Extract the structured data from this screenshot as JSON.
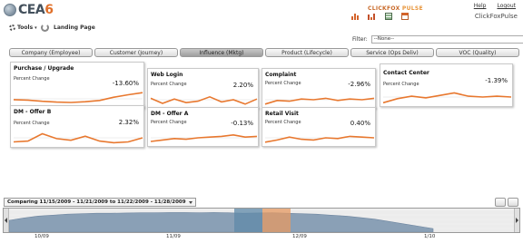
{
  "header": {
    "logo_text": "CEA",
    "logo_six": "6",
    "brand_left": "CLICKFOX",
    "brand_right": "PULSE",
    "links": [
      "Help",
      "Logout"
    ],
    "product_name": "ClickFoxPulse",
    "icons": [
      "bar-chart-icon",
      "column-chart-icon",
      "grid-icon",
      "calendar-icon"
    ]
  },
  "toolbar": {
    "tools_label": "Tools",
    "landing_label": "Landing Page"
  },
  "filter": {
    "label": "Filter:",
    "value": "--None--"
  },
  "tabs": [
    {
      "label": "Company (Employee)",
      "active": false
    },
    {
      "label": "Customer (Journey)",
      "active": false
    },
    {
      "label": "Influence (Mktg)",
      "active": true
    },
    {
      "label": "Product (Lifecycle)",
      "active": false
    },
    {
      "label": "Service (Ops Deliv)",
      "active": false
    },
    {
      "label": "VOC (Quality)",
      "active": false
    }
  ],
  "accent_color": "#e8782f",
  "cards": [
    {
      "title": "Purchase / Upgrade",
      "subtitle": "Percent Change",
      "value": "-13.60%",
      "series": [
        0.45,
        0.42,
        0.35,
        0.3,
        0.28,
        0.32,
        0.4,
        0.6,
        0.75,
        0.88
      ]
    },
    {
      "title": "Web Login",
      "subtitle": "Percent Change",
      "value": "2.20%",
      "series": [
        0.6,
        0.25,
        0.55,
        0.3,
        0.4,
        0.7,
        0.35,
        0.5,
        0.2,
        0.55
      ]
    },
    {
      "title": "Complaint",
      "subtitle": "Percent Change",
      "value": "-2.96%",
      "series": [
        0.2,
        0.45,
        0.4,
        0.55,
        0.5,
        0.6,
        0.45,
        0.55,
        0.5,
        0.6
      ]
    },
    {
      "title": "Contact Center",
      "subtitle": "Percent Change",
      "value": "-1.39%",
      "series": [
        0.15,
        0.4,
        0.55,
        0.45,
        0.6,
        0.75,
        0.55,
        0.5,
        0.55,
        0.5
      ]
    },
    {
      "title": "DM - Offer B",
      "subtitle": "Percent Change",
      "value": "2.32%",
      "series": [
        0.25,
        0.3,
        0.75,
        0.45,
        0.35,
        0.6,
        0.3,
        0.2,
        0.25,
        0.5
      ]
    },
    {
      "title": "DM - Offer A",
      "subtitle": "Percent Change",
      "value": "-0.13%",
      "series": [
        0.25,
        0.35,
        0.45,
        0.4,
        0.5,
        0.55,
        0.6,
        0.7,
        0.55,
        0.6
      ]
    },
    {
      "title": "Retail Visit",
      "subtitle": "Percent Change",
      "value": "0.40%",
      "series": [
        0.2,
        0.35,
        0.55,
        0.4,
        0.35,
        0.5,
        0.45,
        0.6,
        0.55,
        0.5
      ]
    }
  ],
  "comparison": {
    "label": "Comparing 11/15/2009 - 11/21/2009 to 11/22/2009 - 11/28/2009"
  },
  "timeline": {
    "tick_labels": [
      "10/09",
      "11/09",
      "12/09",
      "1/10"
    ],
    "area_series": [
      0.5,
      0.6,
      0.68,
      0.72,
      0.76,
      0.78,
      0.8,
      0.8,
      0.81,
      0.82,
      0.82,
      0.83,
      0.83,
      0.82,
      0.83,
      0.82,
      0.8,
      0.81,
      0.82,
      0.8,
      0.78,
      0.76,
      0.72,
      0.68,
      0.62,
      0.55,
      0.45,
      0.35,
      0.25,
      0.15
    ],
    "highlight_a_color": "#5f8aa8",
    "highlight_b_color": "#e69a62"
  }
}
